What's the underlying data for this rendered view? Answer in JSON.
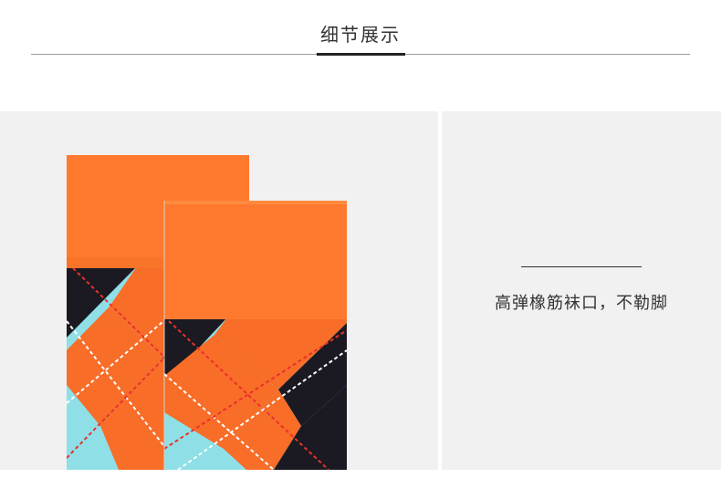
{
  "section": {
    "title": "细节展示"
  },
  "detail": {
    "description": "高弹橡筋袜口，不勒脚"
  },
  "product": {
    "image_icon": "argyle-socks-image",
    "colors": {
      "cuff": "#ff7a2e",
      "orange": "#f86d28",
      "navy": "#1b1a22",
      "cyan": "#8fdfe7",
      "red_stitch": "#e8322a",
      "white_stitch": "#ffffff"
    }
  }
}
